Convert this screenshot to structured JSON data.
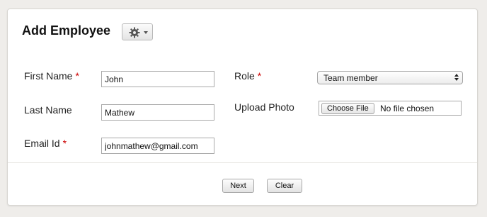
{
  "header": {
    "title": "Add Employee",
    "settings_icon": "gear-icon"
  },
  "form": {
    "first_name": {
      "label": "First Name",
      "required_mark": "*",
      "value": "John"
    },
    "last_name": {
      "label": "Last Name",
      "value": "Mathew"
    },
    "email": {
      "label": "Email Id",
      "required_mark": "*",
      "value": "johnmathew@gmail.com"
    },
    "role": {
      "label": "Role",
      "required_mark": "*",
      "selected": "Team member"
    },
    "photo": {
      "label": "Upload Photo",
      "button_label": "Choose File",
      "status": "No file chosen"
    }
  },
  "actions": {
    "next_label": "Next",
    "clear_label": "Clear"
  },
  "colors": {
    "background": "#efedea",
    "required": "#cc0000"
  }
}
